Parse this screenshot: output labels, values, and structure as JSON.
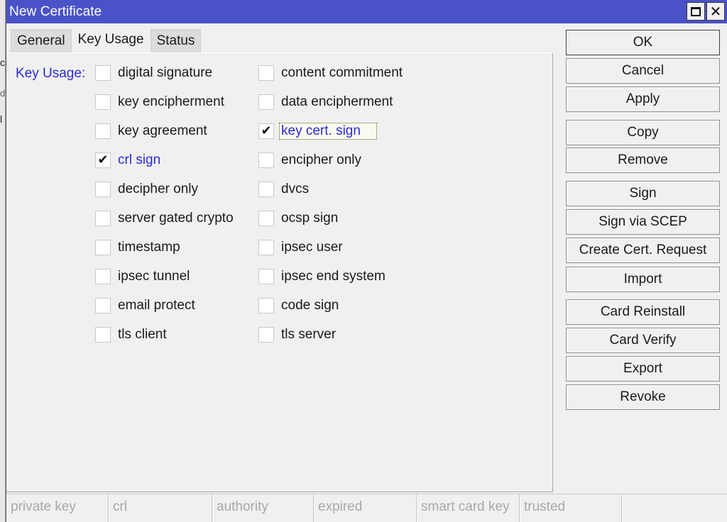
{
  "window": {
    "title": "New Certificate"
  },
  "background_fragments": [
    "c",
    "d",
    "l"
  ],
  "tabs": [
    {
      "label": "General",
      "active": false
    },
    {
      "label": "Key Usage",
      "active": true
    },
    {
      "label": "Status",
      "active": false
    }
  ],
  "key_usage": {
    "label": "Key Usage:",
    "options": [
      {
        "label": "digital signature",
        "checked": false
      },
      {
        "label": "content commitment",
        "checked": false
      },
      {
        "label": "key encipherment",
        "checked": false
      },
      {
        "label": "data encipherment",
        "checked": false
      },
      {
        "label": "key agreement",
        "checked": false
      },
      {
        "label": "key cert. sign",
        "checked": true,
        "focused": true
      },
      {
        "label": "crl sign",
        "checked": true
      },
      {
        "label": "encipher only",
        "checked": false
      },
      {
        "label": "decipher only",
        "checked": false
      },
      {
        "label": "dvcs",
        "checked": false
      },
      {
        "label": "server gated crypto",
        "checked": false
      },
      {
        "label": "ocsp sign",
        "checked": false
      },
      {
        "label": "timestamp",
        "checked": false
      },
      {
        "label": "ipsec user",
        "checked": false
      },
      {
        "label": "ipsec tunnel",
        "checked": false
      },
      {
        "label": "ipsec end system",
        "checked": false
      },
      {
        "label": "email protect",
        "checked": false
      },
      {
        "label": "code sign",
        "checked": false
      },
      {
        "label": "tls client",
        "checked": false
      },
      {
        "label": "tls server",
        "checked": false
      }
    ]
  },
  "buttons": {
    "ok": "OK",
    "cancel": "Cancel",
    "apply": "Apply",
    "copy": "Copy",
    "remove": "Remove",
    "sign": "Sign",
    "sign_via_scep": "Sign via SCEP",
    "create_cert_request": "Create Cert. Request",
    "import": "Import",
    "card_reinstall": "Card Reinstall",
    "card_verify": "Card Verify",
    "export": "Export",
    "revoke": "Revoke"
  },
  "status_bar": [
    "private key",
    "crl",
    "authority",
    "expired",
    "smart card key",
    "trusted",
    ""
  ],
  "colors": {
    "titlebar": "#4a52c8",
    "checked_label": "#2b2bd6",
    "status_text": "#a8a8a8"
  }
}
